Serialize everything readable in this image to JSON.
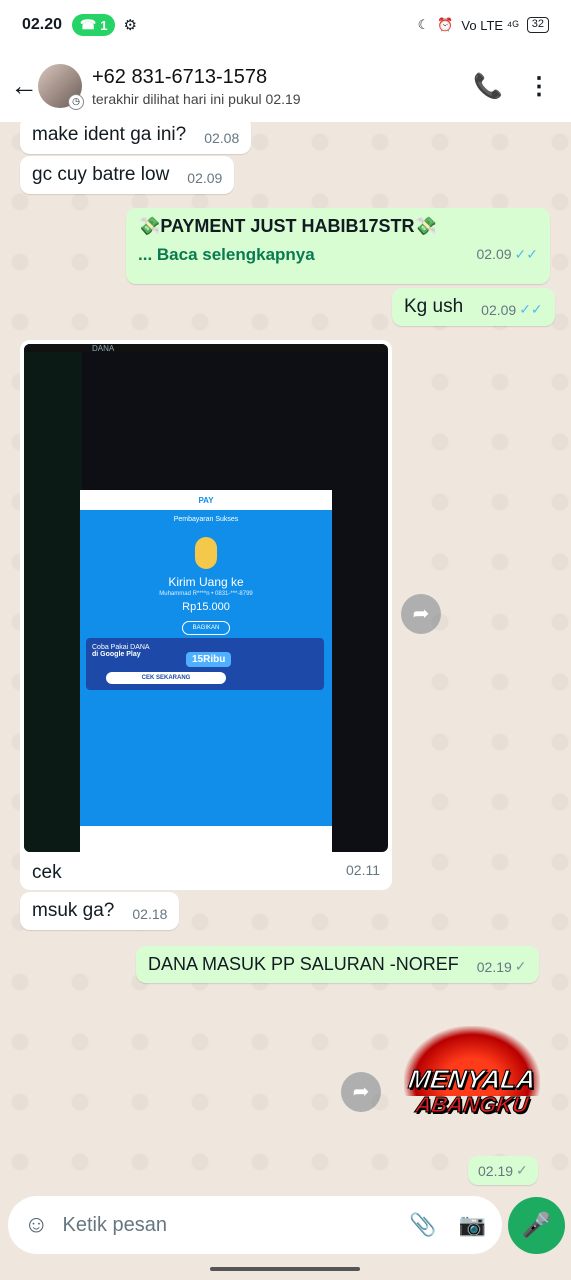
{
  "status_bar": {
    "time": "02.20",
    "pill_count": "1",
    "signal": "Vo LTE ⁴ᴳ",
    "battery": "32"
  },
  "header": {
    "contact": "+62 831-6713-1578",
    "subtitle": "terakhir dilihat hari ini pukul 02.19"
  },
  "messages": {
    "m1": {
      "text": "make ident ga ini?",
      "time": "02.08"
    },
    "m2": {
      "text": "gc cuy batre low",
      "time": "02.09"
    },
    "m3": {
      "title": "💸PAYMENT JUST HABIB17STR💸",
      "more": "... Baca selengkapnya",
      "time": "02.09"
    },
    "m4": {
      "text": "Kg ush",
      "time": "02.09"
    },
    "m5": {
      "caption": "cek",
      "time": "02.11"
    },
    "m6": {
      "text": "msuk ga?",
      "time": "02.18"
    },
    "m7": {
      "text": "DANA MASUK PP SALURAN -NOREF",
      "time": "02.19"
    },
    "m8": {
      "time": "02.19"
    }
  },
  "screenshot": {
    "app": "DANA",
    "header": "PAY",
    "status": "Pembayaran Sukses",
    "title": "Kirim Uang ke",
    "recipient": "Muhammad R****n • 0831-***-8799",
    "amount": "Rp15.000",
    "share": "BAGIKAN",
    "ad_line1": "Coba Pakai DANA",
    "ad_line2": "di Google Play",
    "ad_big": "15Ribu",
    "ad_cta": "CEK SEKARANG"
  },
  "sticker": {
    "line1": "MENYALA",
    "line2": "ABANGKU"
  },
  "composer": {
    "placeholder": "Ketik pesan"
  },
  "icons": {
    "back": "back-arrow-icon",
    "call": "add-call-icon",
    "menu": "more-vert-icon",
    "emoji": "sticker-icon",
    "attach": "paperclip-icon",
    "camera": "camera-icon",
    "mic": "mic-icon",
    "forward": "forward-icon"
  }
}
